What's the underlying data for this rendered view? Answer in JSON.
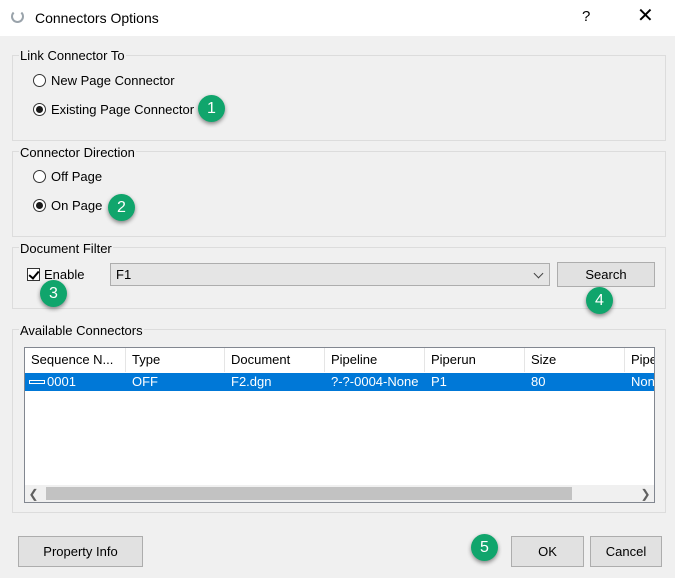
{
  "window": {
    "title": "Connectors Options",
    "help_label": "?",
    "close_label": "✕"
  },
  "link_group": {
    "legend": "Link Connector To",
    "options": [
      {
        "label": "New Page Connector",
        "checked": false
      },
      {
        "label": "Existing Page Connector",
        "checked": true
      }
    ]
  },
  "direction_group": {
    "legend": "Connector Direction",
    "options": [
      {
        "label": "Off Page",
        "checked": false
      },
      {
        "label": "On Page",
        "checked": true
      }
    ]
  },
  "filter_group": {
    "legend": "Document Filter",
    "enable_label": "Enable",
    "enable_checked": true,
    "document_value": "F1",
    "search_label": "Search"
  },
  "connectors_group": {
    "legend": "Available Connectors",
    "columns": [
      "Sequence N...",
      "Type",
      "Document",
      "Pipeline",
      "Piperun",
      "Size",
      "Pipe"
    ],
    "rows": [
      [
        "0001",
        "OFF",
        "F2.dgn",
        "?-?-0004-None",
        "P1",
        "80",
        "Non"
      ]
    ]
  },
  "callouts": [
    "1",
    "2",
    "3",
    "4",
    "5"
  ],
  "footer": {
    "property_info_label": "Property Info",
    "ok_label": "OK",
    "cancel_label": "Cancel"
  },
  "colors": {
    "callout": "#10a56c",
    "selection": "#0078d7"
  }
}
